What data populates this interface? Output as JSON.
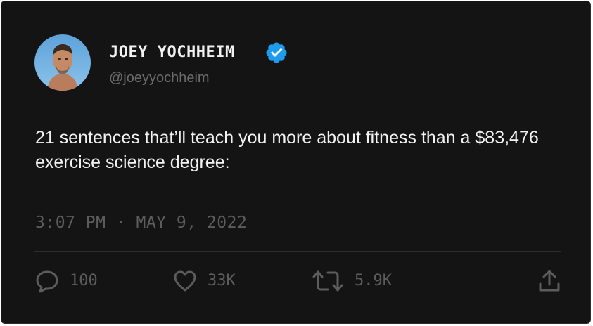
{
  "user": {
    "display_name": "JOEY YOCHHEIM",
    "handle": "@joeyyochheim",
    "verified": true
  },
  "tweet": {
    "text": "21 sentences that’ll teach you more about fitness than a $83,476 exercise science degree:",
    "timestamp": "3:07 PM · MAY 9, 2022"
  },
  "actions": {
    "replies": "100",
    "likes": "33K",
    "retweets": "5.9K"
  },
  "icons": {
    "verified": "verified-badge-icon",
    "reply": "speech-bubble-icon",
    "like": "heart-icon",
    "retweet": "retweet-arrows-icon",
    "share": "share-upload-icon"
  },
  "colors": {
    "background": "#141414",
    "text_primary": "#f2f2f2",
    "text_muted": "#5c5c5c",
    "verified_blue": "#1d9bf0"
  }
}
